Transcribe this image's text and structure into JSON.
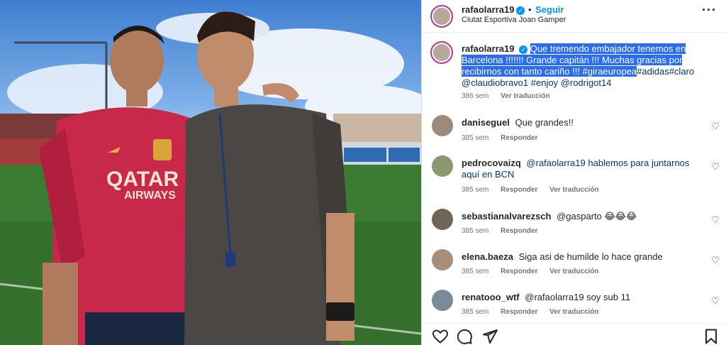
{
  "post": {
    "username": "rafaolarra19",
    "follow_label": "Seguir",
    "dot": "•",
    "location": "Ciutat Esportiva Joan Gamper",
    "more_label": "···",
    "verified_glyph": "✓",
    "caption": {
      "username": "rafaolarra19",
      "text_highlighted": "Que tremendo embajador tenemos en Barcelona !!!!!!! Grande capitán !!! Muchas gracias por recibirnos con tanto cariño !!! #giraeuropea",
      "text_rest": "#adidas#claro @claudiobravo1 #enjoy @rodrigot14",
      "time": "386 sem",
      "translate_label": "Ver traducción"
    },
    "comments": [
      {
        "username": "daniseguel",
        "text": "Que grandes!!",
        "time": "385 sem",
        "reply_label": "Responder",
        "translate_label": ""
      },
      {
        "username": "pedrocovaizq",
        "text": "@rafaolarra19 hablemos para juntarnos aquí en BCN",
        "time": "385 sem",
        "reply_label": "Responder",
        "translate_label": "Ver traducción"
      },
      {
        "username": "sebastianalvarezsch",
        "text": "@gasparto 😂😂😂",
        "time": "385 sem",
        "reply_label": "Responder",
        "translate_label": ""
      },
      {
        "username": "elena.baeza",
        "text": "Siga asi de humilde lo hace grande",
        "time": "385 sem",
        "reply_label": "Responder",
        "translate_label": "Ver traducción"
      },
      {
        "username": "renatooo_wtf",
        "text": "@rafaolarra19 soy sub 11",
        "time": "385 sem",
        "reply_label": "Responder",
        "translate_label": "Ver traducción"
      }
    ],
    "photo": {
      "shirt_sponsor_line1": "QATAR",
      "shirt_sponsor_line2": "AIRWAYS"
    },
    "colors": {
      "accent": "#0095f6",
      "highlight": "#2a6df0",
      "muted": "#737373",
      "shirt": "#c8284a"
    }
  }
}
